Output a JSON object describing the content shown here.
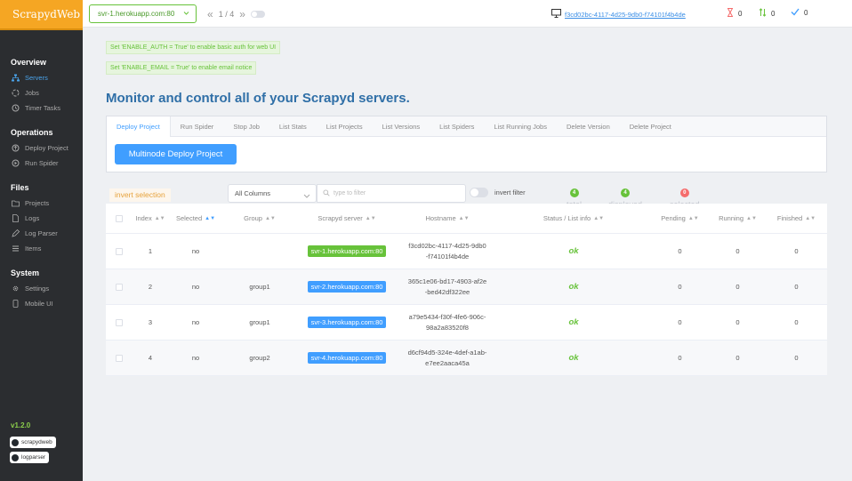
{
  "brand": "ScrapydWeb",
  "version": "v1.2.0",
  "github_links": [
    "scrapydweb",
    "logparser"
  ],
  "nav": [
    {
      "section": "Overview",
      "items": [
        {
          "label": "Servers",
          "icon": "sitemap-icon",
          "active": true
        },
        {
          "label": "Jobs",
          "icon": "spinner-icon"
        },
        {
          "label": "Timer Tasks",
          "icon": "clock-icon"
        }
      ]
    },
    {
      "section": "Operations",
      "items": [
        {
          "label": "Deploy Project",
          "icon": "upload-icon"
        },
        {
          "label": "Run Spider",
          "icon": "play-icon"
        }
      ]
    },
    {
      "section": "Files",
      "items": [
        {
          "label": "Projects",
          "icon": "folder-icon"
        },
        {
          "label": "Logs",
          "icon": "document-icon"
        },
        {
          "label": "Log Parser",
          "icon": "edit-icon"
        },
        {
          "label": "Items",
          "icon": "list-icon"
        }
      ]
    },
    {
      "section": "System",
      "items": [
        {
          "label": "Settings",
          "icon": "gear-icon"
        },
        {
          "label": "Mobile UI",
          "icon": "mobile-icon"
        }
      ]
    }
  ],
  "topbar": {
    "server_select": "svr-1.herokuapp.com:80",
    "pager": "1 / 4",
    "node_id": "f3cd02bc-4117-4d25-9db0-f74101f4b4de",
    "counters": {
      "pending": "0",
      "running": "0",
      "finished": "0"
    }
  },
  "hints": [
    "Set 'ENABLE_AUTH = True' to enable basic auth for web UI",
    "Set 'ENABLE_EMAIL = True' to enable email notice"
  ],
  "page_title": "Monitor and control all of your Scrapyd servers.",
  "tabs": [
    "Deploy Project",
    "Run Spider",
    "Stop Job",
    "List Stats",
    "List Projects",
    "List Versions",
    "List Spiders",
    "List Running Jobs",
    "Delete Version",
    "Delete Project"
  ],
  "deploy_button": "Multinode Deploy Project",
  "filters": {
    "invert_selection": "invert selection",
    "column_select": "All Columns",
    "filter_placeholder": "type to filter",
    "invert_filter": "invert filter"
  },
  "stats": {
    "total": {
      "label": "total",
      "count": "4"
    },
    "displayed": {
      "label": "displayed",
      "count": "4"
    },
    "selected": {
      "label": "selected",
      "count": "0"
    }
  },
  "table": {
    "headers": [
      "Index",
      "Selected",
      "Group",
      "Scrapyd server",
      "Hostname",
      "Status / List info",
      "Pending",
      "Running",
      "Finished"
    ],
    "rows": [
      {
        "index": "1",
        "selected": "no",
        "group": "",
        "server": "svr-1.herokuapp.com:80",
        "hostname_a": "f3cd02bc-4117-4d25-9db0",
        "hostname_b": "-f74101f4b4de",
        "status": "ok",
        "pending": "0",
        "running": "0",
        "finished": "0"
      },
      {
        "index": "2",
        "selected": "no",
        "group": "group1",
        "server": "svr-2.herokuapp.com:80",
        "hostname_a": "365c1e06-bd17-4903-af2e",
        "hostname_b": "-bed42df322ee",
        "status": "ok",
        "pending": "0",
        "running": "0",
        "finished": "0"
      },
      {
        "index": "3",
        "selected": "no",
        "group": "group1",
        "server": "svr-3.herokuapp.com:80",
        "hostname_a": "a79e5434-f30f-4fe6-906c-",
        "hostname_b": "98a2a83520f8",
        "status": "ok",
        "pending": "0",
        "running": "0",
        "finished": "0"
      },
      {
        "index": "4",
        "selected": "no",
        "group": "group2",
        "server": "svr-4.herokuapp.com:80",
        "hostname_a": "d6cf94d5-324e-4def-a1ab-",
        "hostname_b": "e7ee2aaca45a",
        "status": "ok",
        "pending": "0",
        "running": "0",
        "finished": "0"
      }
    ]
  },
  "colors": {
    "accent": "#409eff",
    "brand": "#f5a623",
    "success": "#67c23a",
    "danger": "#f56c6c"
  }
}
